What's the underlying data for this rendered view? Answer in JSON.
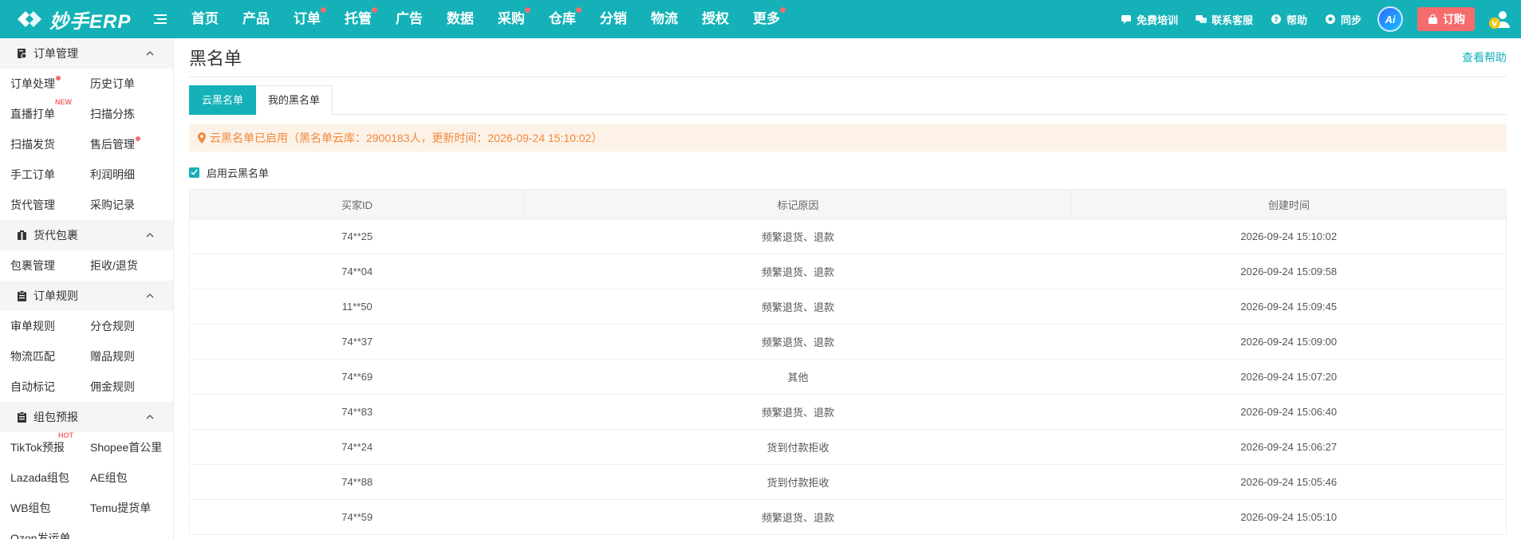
{
  "app": {
    "logo_text": "妙手ERP",
    "brand_color": "#14b2b8",
    "alert_color": "#f56c6c"
  },
  "nav": [
    {
      "label": "首页",
      "dot": false
    },
    {
      "label": "产品",
      "dot": false
    },
    {
      "label": "订单",
      "dot": true
    },
    {
      "label": "托管",
      "dot": true
    },
    {
      "label": "广告",
      "dot": false
    },
    {
      "label": "数据",
      "dot": false
    },
    {
      "label": "采购",
      "dot": true
    },
    {
      "label": "仓库",
      "dot": true
    },
    {
      "label": "分销",
      "dot": false
    },
    {
      "label": "物流",
      "dot": false
    },
    {
      "label": "授权",
      "dot": false
    },
    {
      "label": "更多",
      "dot": true
    }
  ],
  "top_right": {
    "training": "免费培训",
    "support": "联系客服",
    "help": "帮助",
    "sync": "同步",
    "ai": "Ai",
    "order": "订购"
  },
  "sidebar": {
    "groups": [
      {
        "title": "订单管理",
        "icon": "order-doc-icon",
        "items": [
          {
            "label": "订单处理",
            "dot": true
          },
          {
            "label": "历史订单"
          },
          {
            "label": "直播打单",
            "tag": "NEW"
          },
          {
            "label": "扫描分拣"
          },
          {
            "label": "扫描发货"
          },
          {
            "label": "售后管理",
            "dot": true
          },
          {
            "label": "手工订单"
          },
          {
            "label": "利润明细"
          },
          {
            "label": "货代管理"
          },
          {
            "label": "采购记录"
          }
        ]
      },
      {
        "title": "货代包裹",
        "icon": "package-icon",
        "items": [
          {
            "label": "包裹管理"
          },
          {
            "label": "拒收/退货"
          }
        ]
      },
      {
        "title": "订单规则",
        "icon": "clipboard-icon",
        "items": [
          {
            "label": "审单规则"
          },
          {
            "label": "分仓规则"
          },
          {
            "label": "物流匹配"
          },
          {
            "label": "赠品规则"
          },
          {
            "label": "自动标记"
          },
          {
            "label": "佣金规则"
          }
        ]
      },
      {
        "title": "组包预报",
        "icon": "clipboard-icon",
        "items": [
          {
            "label": "TikTok预报",
            "tag": "HOT"
          },
          {
            "label": "Shopee首公里"
          },
          {
            "label": "Lazada组包"
          },
          {
            "label": "AE组包"
          },
          {
            "label": "WB组包"
          },
          {
            "label": "Temu提货单"
          },
          {
            "label": "Ozon发运单"
          }
        ]
      }
    ]
  },
  "page": {
    "title": "黑名单",
    "help_link": "查看帮助",
    "tabs": [
      {
        "label": "云黑名单",
        "active": true
      },
      {
        "label": "我的黑名单",
        "active": false
      }
    ],
    "notice": "云黑名单已启用（黑名单云库：2900183人，更新时间：2026-09-24 15:10:02）",
    "enable_label": "启用云黑名单",
    "enable_checked": true,
    "table": {
      "columns": [
        "买家ID",
        "标记原因",
        "创建时间"
      ],
      "rows": [
        [
          "74**25",
          "频繁退货、退款",
          "2026-09-24 15:10:02"
        ],
        [
          "74**04",
          "频繁退货、退款",
          "2026-09-24 15:09:58"
        ],
        [
          "11**50",
          "频繁退货、退款",
          "2026-09-24 15:09:45"
        ],
        [
          "74**37",
          "频繁退货、退款",
          "2026-09-24 15:09:00"
        ],
        [
          "74**69",
          "其他",
          "2026-09-24 15:07:20"
        ],
        [
          "74**83",
          "频繁退货、退款",
          "2026-09-24 15:06:40"
        ],
        [
          "74**24",
          "货到付款拒收",
          "2026-09-24 15:06:27"
        ],
        [
          "74**88",
          "货到付款拒收",
          "2026-09-24 15:05:46"
        ],
        [
          "74**59",
          "频繁退货、退款",
          "2026-09-24 15:05:10"
        ]
      ]
    }
  }
}
